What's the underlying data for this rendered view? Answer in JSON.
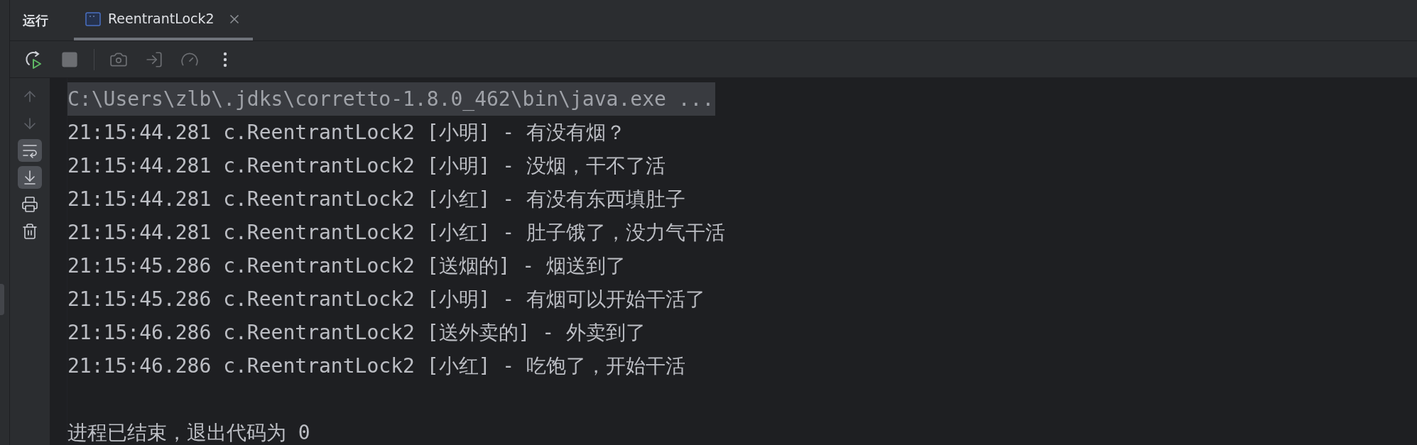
{
  "tool_window": {
    "title": "运行",
    "tabs": [
      {
        "label": "ReentrantLock2",
        "selected": true
      }
    ]
  },
  "toolbar": [
    {
      "kind": "rerun",
      "disabled": false
    },
    {
      "kind": "stop",
      "disabled": true
    },
    {
      "kind": "separator"
    },
    {
      "kind": "screenshot",
      "disabled": true
    },
    {
      "kind": "attach",
      "disabled": true
    },
    {
      "kind": "profile",
      "disabled": true
    },
    {
      "kind": "more",
      "disabled": false
    }
  ],
  "side_buttons": [
    {
      "kind": "up",
      "selected": false,
      "disabled": true
    },
    {
      "kind": "down",
      "selected": false,
      "disabled": true
    },
    {
      "kind": "wrap",
      "selected": true,
      "disabled": false
    },
    {
      "kind": "scroll_end",
      "selected": true,
      "disabled": false
    },
    {
      "kind": "print",
      "selected": false,
      "disabled": false
    },
    {
      "kind": "clear",
      "selected": false,
      "disabled": false
    }
  ],
  "console": {
    "command": "C:\\Users\\zlb\\.jdks\\corretto-1.8.0_462\\bin\\java.exe ...",
    "lines": [
      "21:15:44.281 c.ReentrantLock2 [小明] - 有没有烟？",
      "21:15:44.281 c.ReentrantLock2 [小明] - 没烟，干不了活",
      "21:15:44.281 c.ReentrantLock2 [小红] - 有没有东西填肚子",
      "21:15:44.281 c.ReentrantLock2 [小红] - 肚子饿了，没力气干活",
      "21:15:45.286 c.ReentrantLock2 [送烟的] - 烟送到了",
      "21:15:45.286 c.ReentrantLock2 [小明] - 有烟可以开始干活了",
      "21:15:46.286 c.ReentrantLock2 [送外卖的] - 外卖到了",
      "21:15:46.286 c.ReentrantLock2 [小红] - 吃饱了，开始干活"
    ],
    "exit_message": "进程已结束，退出代码为 0"
  }
}
